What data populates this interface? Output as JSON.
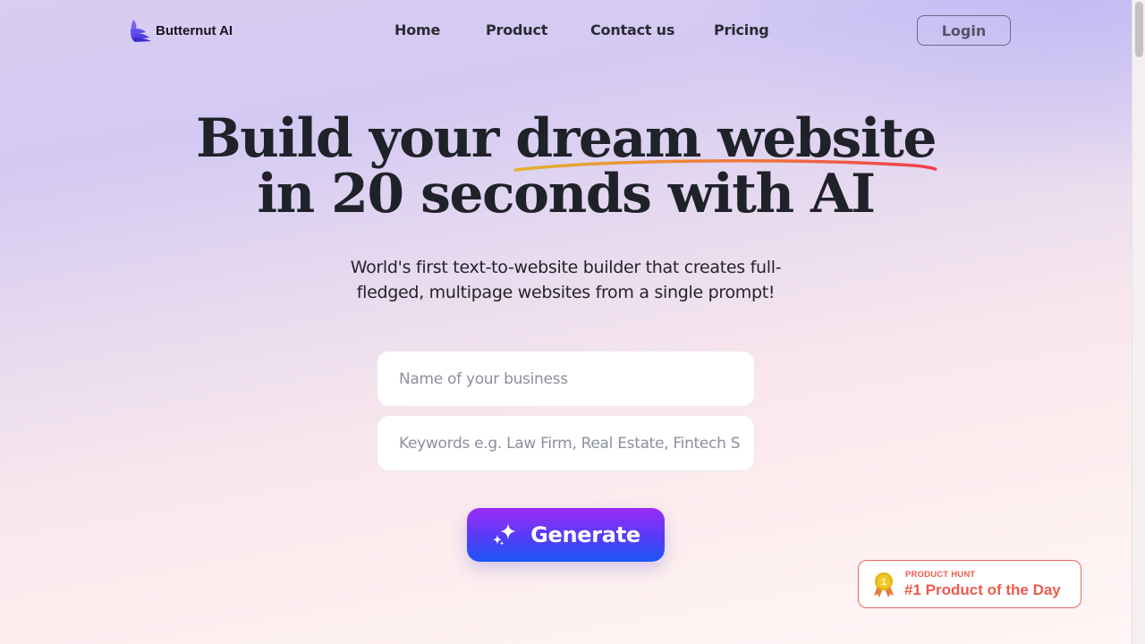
{
  "brand": {
    "name": "Butternut AI",
    "logo_icon": "layered-wing-icon",
    "logo_color": "#5b45e8"
  },
  "nav": {
    "items": [
      {
        "label": "Home"
      },
      {
        "label": "Product"
      },
      {
        "label": "Contact us"
      },
      {
        "label": "Pricing"
      }
    ],
    "login_label": "Login"
  },
  "hero": {
    "title_line1_prefix": "Build your ",
    "title_highlight": "dream website",
    "title_line2": "in 20 seconds with AI",
    "underline_colors": [
      "#e0b22e",
      "#f07a3a",
      "#ef3f4c"
    ],
    "subtitle_line1": "World's first text-to-website builder that creates full-",
    "subtitle_line2": "fledged, multipage websites from a single prompt!"
  },
  "form": {
    "business_name": {
      "value": "",
      "placeholder": "Name of your business"
    },
    "keywords": {
      "value": "",
      "placeholder": "Keywords e.g. Law Firm, Real Estate, Fintech S"
    },
    "generate_label": "Generate",
    "generate_icon": "sparkles-icon"
  },
  "badge": {
    "source": "PRODUCT HUNT",
    "title": "#1 Product of the Day",
    "icon": "medal-icon",
    "medal_number": "1",
    "color": "#ee5a4f"
  }
}
